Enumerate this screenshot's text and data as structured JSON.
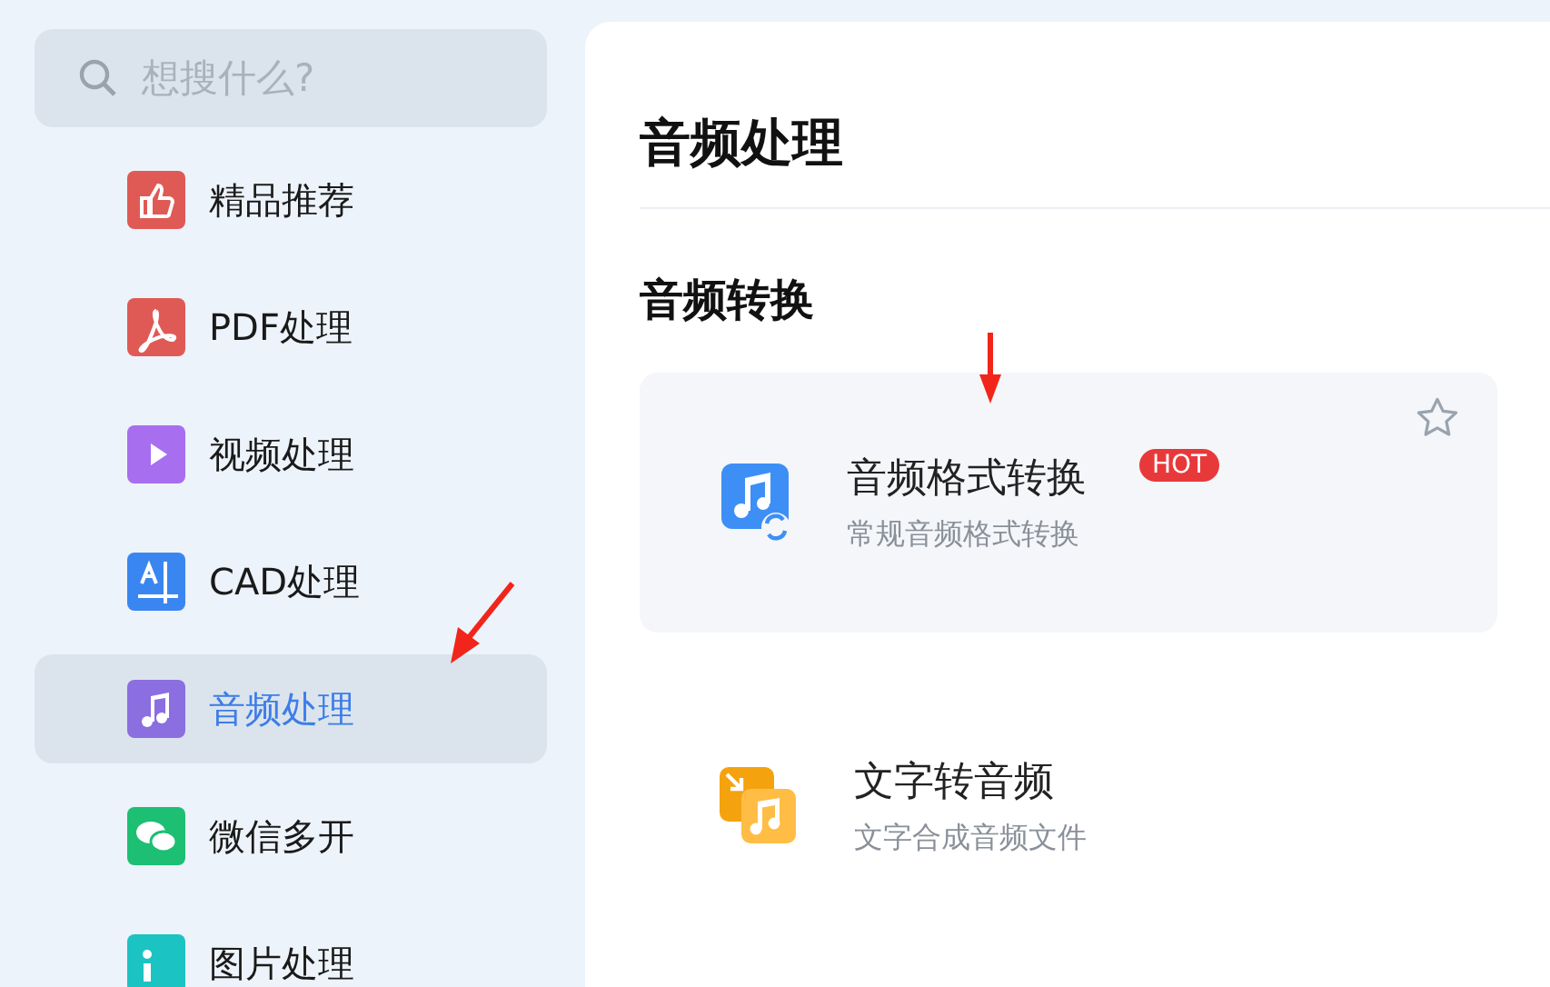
{
  "search": {
    "placeholder": "想搜什么?"
  },
  "sidebar": {
    "items": [
      {
        "label": "精品推荐",
        "kind": "thumb",
        "selected": false
      },
      {
        "label": "PDF处理",
        "kind": "pdf",
        "selected": false
      },
      {
        "label": "视频处理",
        "kind": "video",
        "selected": false
      },
      {
        "label": "CAD处理",
        "kind": "cad",
        "selected": false
      },
      {
        "label": "音频处理",
        "kind": "audio",
        "selected": true
      },
      {
        "label": "微信多开",
        "kind": "chat",
        "selected": false
      },
      {
        "label": "图片处理",
        "kind": "image",
        "selected": false
      }
    ]
  },
  "page": {
    "title": "音频处理",
    "section": "音频转换",
    "tools": [
      {
        "kind": "convert",
        "title": "音频格式转换",
        "subtitle": "常规音频格式转换",
        "badge": "HOT",
        "hovered": true
      },
      {
        "kind": "tts",
        "title": "文字转音频",
        "subtitle": "文字合成音频文件",
        "hovered": false
      }
    ]
  }
}
